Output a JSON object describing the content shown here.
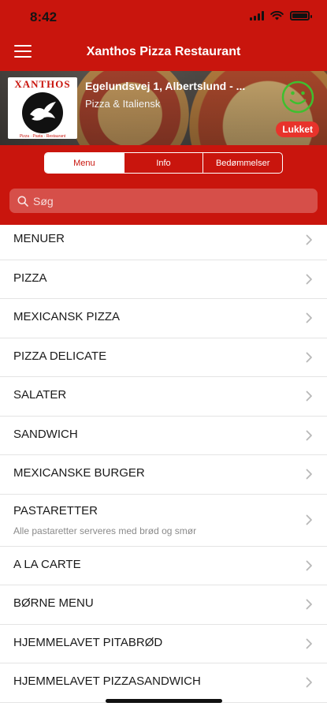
{
  "status_bar": {
    "time": "8:42"
  },
  "nav": {
    "title": "Xanthos Pizza Restaurant"
  },
  "restaurant": {
    "name": "Egelundsvej 1, Albertslund - ...",
    "category": "Pizza & Italiensk",
    "logo_text": "XANTHOS",
    "logo_sub": "Pizza · Pasta · Restaurant",
    "status": "Lukket"
  },
  "tabs": [
    {
      "label": "Menu",
      "active": true
    },
    {
      "label": "Info",
      "active": false
    },
    {
      "label": "Bedømmelser",
      "active": false
    }
  ],
  "search": {
    "placeholder": "Søg"
  },
  "menu_items": [
    {
      "title": "MENUER"
    },
    {
      "title": "PIZZA"
    },
    {
      "title": "MEXICANSK PIZZA"
    },
    {
      "title": "PIZZA DELICATE"
    },
    {
      "title": "SALATER"
    },
    {
      "title": "SANDWICH"
    },
    {
      "title": "MEXICANSKE BURGER"
    },
    {
      "title": "PASTARETTER",
      "subtitle": "Alle pastaretter serveres med brød og smør"
    },
    {
      "title": "A LA CARTE"
    },
    {
      "title": "BØRNE MENU"
    },
    {
      "title": "HJEMMELAVET PITABRØD"
    },
    {
      "title": "HJEMMELAVET PIZZASANDWICH"
    }
  ],
  "colors": {
    "brand_red": "#c9150d",
    "closed_badge": "#e8332b",
    "smiley_green": "#3fbf2f"
  },
  "icons": [
    "hamburger-menu-icon",
    "search-icon",
    "smiley-icon",
    "chevron-right-icon",
    "dove-icon"
  ]
}
